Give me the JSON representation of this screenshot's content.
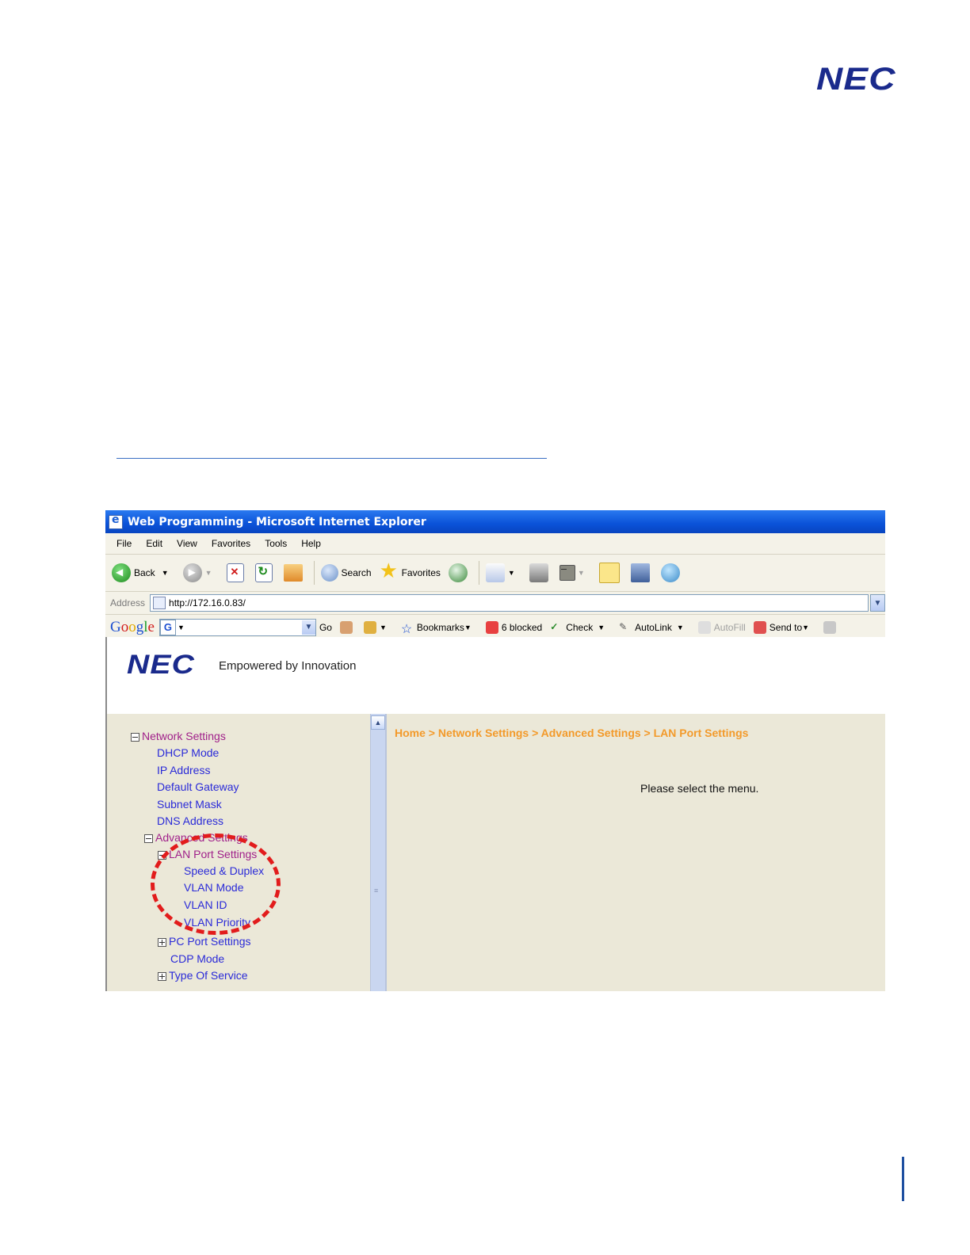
{
  "page": {
    "logo": "NEC"
  },
  "window": {
    "title": "Web Programming - Microsoft Internet Explorer"
  },
  "menubar": [
    "File",
    "Edit",
    "View",
    "Favorites",
    "Tools",
    "Help"
  ],
  "toolbar": {
    "back_label": "Back",
    "search_label": "Search",
    "favorites_label": "Favorites"
  },
  "address": {
    "label": "Address",
    "url": "http://172.16.0.83/"
  },
  "googlebar": {
    "go_label": "Go",
    "bookmarks_label": "Bookmarks",
    "blocked_label": "6 blocked",
    "check_label": "Check",
    "autolink_label": "AutoLink",
    "autofill_label": "AutoFill",
    "sendto_label": "Send to"
  },
  "banner": {
    "logo": "NEC",
    "tagline": "Empowered by Innovation"
  },
  "nav": [
    {
      "label": "Network Settings"
    },
    {
      "label": "DHCP Mode"
    },
    {
      "label": "IP Address"
    },
    {
      "label": "Default Gateway"
    },
    {
      "label": "Subnet Mask"
    },
    {
      "label": "DNS Address"
    },
    {
      "label": "Advanced Settings"
    },
    {
      "label": "LAN Port Settings"
    },
    {
      "label": "Speed & Duplex"
    },
    {
      "label": "VLAN Mode"
    },
    {
      "label": "VLAN ID"
    },
    {
      "label": "VLAN Priority"
    },
    {
      "label": "PC Port Settings"
    },
    {
      "label": "CDP Mode"
    },
    {
      "label": "Type Of Service"
    }
  ],
  "main": {
    "breadcrumb": "Home > Network Settings > Advanced Settings > LAN Port Settings",
    "prompt": "Please select the menu."
  },
  "colors": {
    "accent": "#f39a2a",
    "link": "#2a2ad8",
    "open": "#a0208a",
    "highlight": "#e21c1c",
    "nec": "#1a2a8c"
  }
}
